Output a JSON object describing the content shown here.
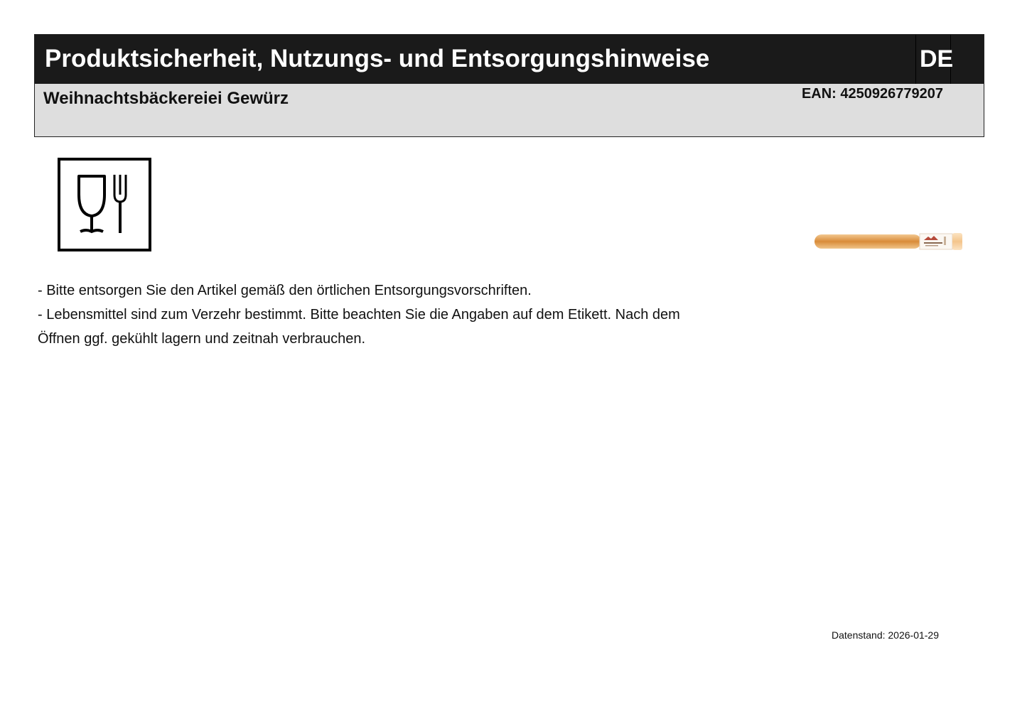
{
  "header": {
    "title": "Produktsicherheit, Nutzungs- und Entsorgungshinweise",
    "language": "DE",
    "product_name": "Weihnachtsbäckereiei Gewürz",
    "ean": "EAN: 4250926779207"
  },
  "icons": {
    "food_contact": "glass-fork-icon",
    "product": "spice-tube-image"
  },
  "colors": {
    "title_bar": "#1a1a1a",
    "subheader_bg": "#dedede",
    "spice": "#d98c3a"
  },
  "notes": [
    "- Bitte entsorgen Sie den Artikel gemäß den örtlichen Entsorgungsvorschriften.",
    "- Lebensmittel sind zum Verzehr bestimmt. Bitte beachten Sie die Angaben auf dem Etikett. Nach dem Öffnen ggf. gekühlt lagern und zeitnah verbrauchen."
  ],
  "footer": {
    "date_stamp": "Datenstand: 2026-01-29"
  }
}
